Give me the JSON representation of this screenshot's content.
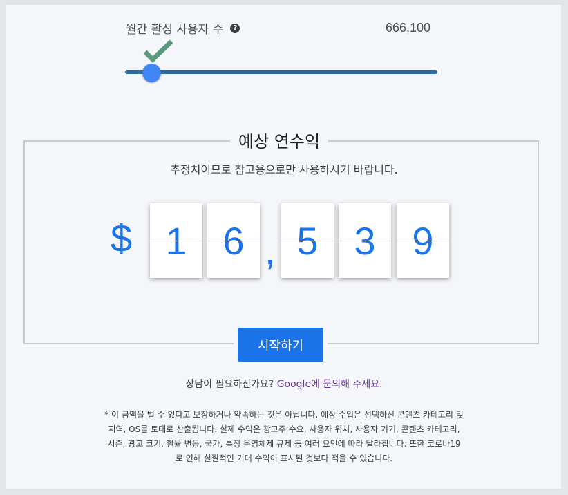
{
  "slider": {
    "label": "월간 활성 사용자 수",
    "help_icon": "?",
    "value": "666,100",
    "level": 0.07
  },
  "revenue": {
    "title": "예상 연수익",
    "subtitle": "추정치이므로 참고용으로만 사용하시기 바랍니다.",
    "currency": "$",
    "separator": ",",
    "digits": [
      "1",
      "6",
      "5",
      "3",
      "9"
    ]
  },
  "start_button": "시작하기",
  "contact": {
    "prefix": "상담이 필요하신가요? ",
    "link": "Google에 문의해 주세요."
  },
  "disclaimer": "* 이 금액을 벌 수 있다고 보장하거나 약속하는 것은 아닙니다. 예상 수입은 선택하신 콘텐츠 카테고리 및 지역, OS를 토대로 산출됩니다. 실제 수익은 광고주 수요, 사용자 위치, 사용자 기기, 콘텐츠 카테고리, 시즌, 광고 크기, 환율 변동, 국가, 특정 운영체제 규제 등 여러 요인에 따라 달라집니다. 또한 코로나19로 인해 실질적인 기대 수익이 표시된 것보다 적을 수 있습니다.",
  "colors": {
    "accent": "#1a73e8",
    "track": "#2e6b9e",
    "thumb": "#4285f4",
    "check": "#5a9a7c"
  },
  "icons": {
    "check": "check-icon",
    "help": "help-icon"
  }
}
